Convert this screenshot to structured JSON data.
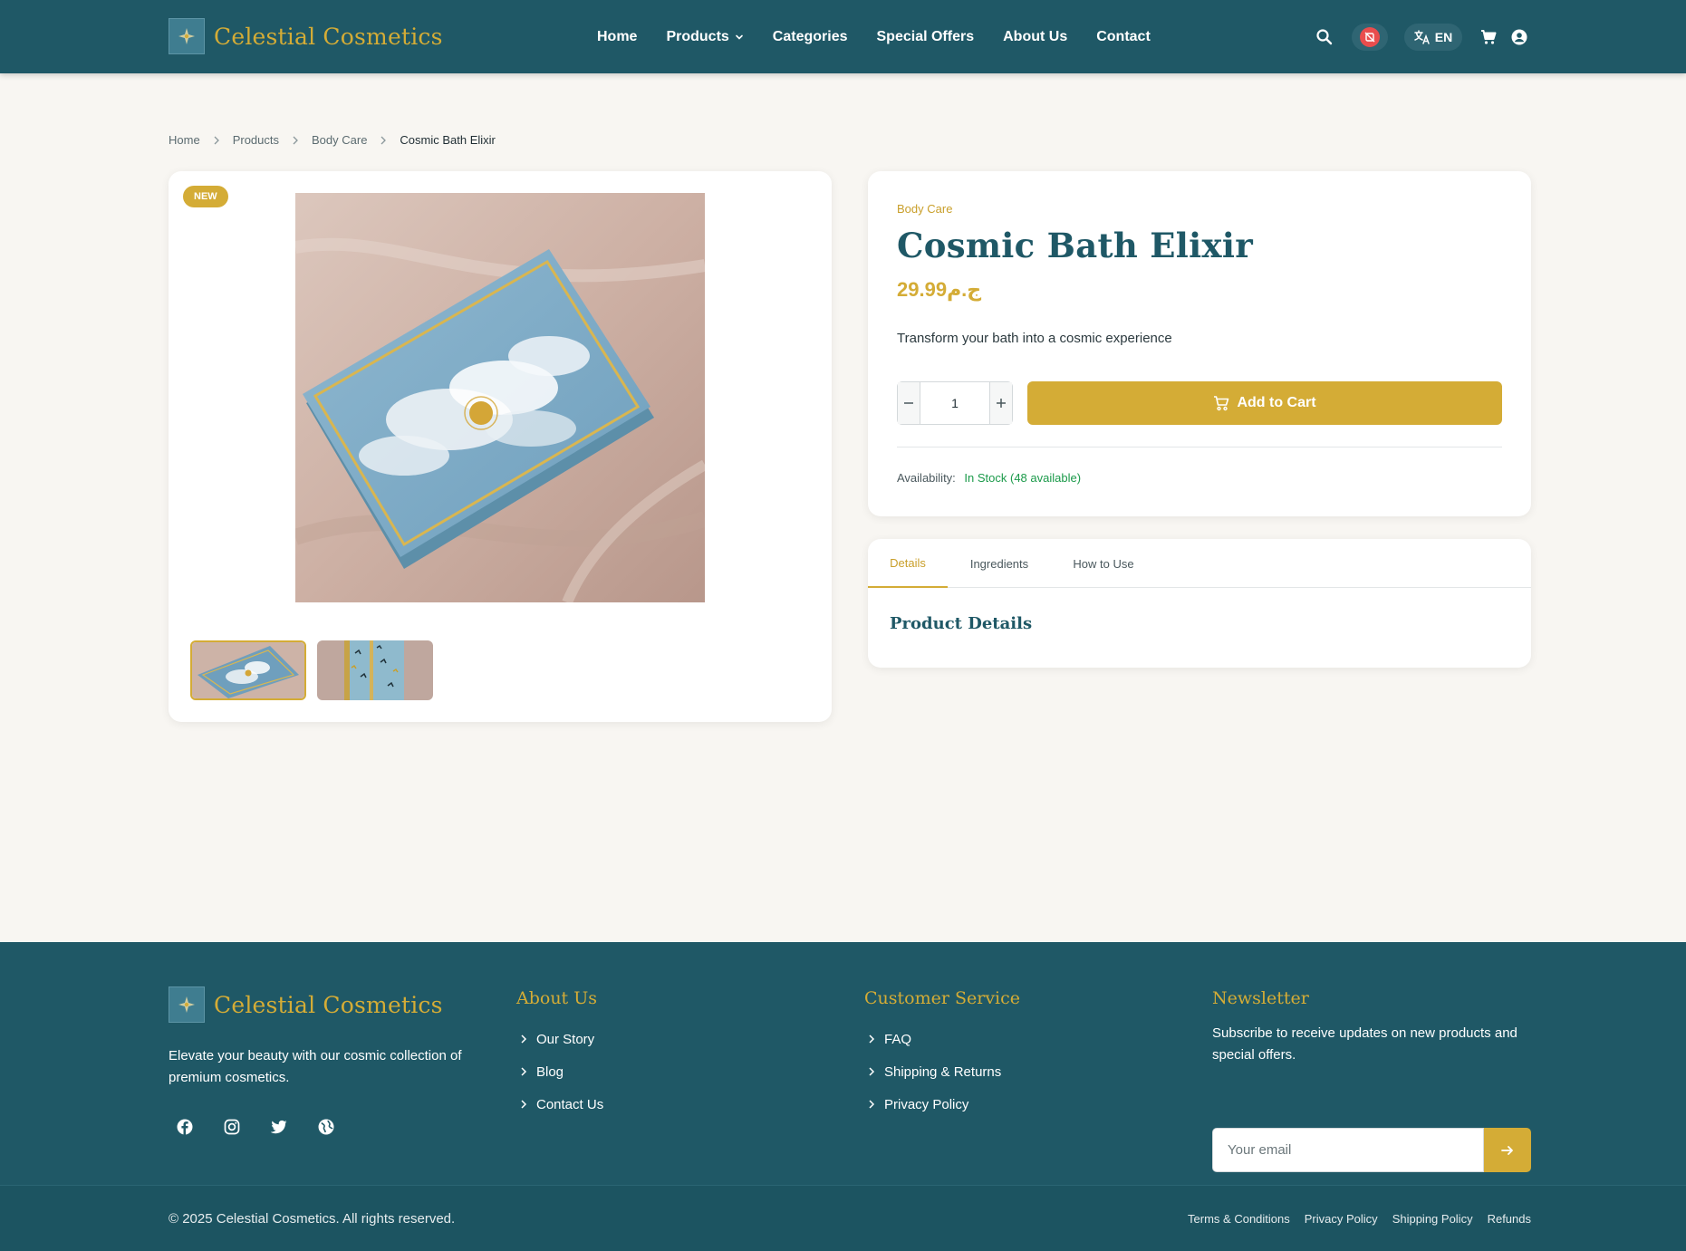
{
  "brand": {
    "name": "Celestial Cosmetics",
    "accent_color": "#d4ac36",
    "primary_color": "#1f5866"
  },
  "nav": {
    "items": [
      {
        "label": "Home"
      },
      {
        "label": "Products"
      },
      {
        "label": "Categories"
      },
      {
        "label": "Special Offers"
      },
      {
        "label": "About Us"
      },
      {
        "label": "Contact"
      }
    ],
    "language": "EN",
    "icons": [
      "search-icon",
      "notifications-off-icon",
      "translate-icon",
      "cart-icon",
      "account-icon"
    ]
  },
  "breadcrumb": [
    "Home",
    "Products",
    "Body Care",
    "Cosmic Bath Elixir"
  ],
  "gallery": {
    "badge": "NEW",
    "selected_thumbnail": 1
  },
  "product": {
    "category": "Body Care",
    "title": "Cosmic Bath Elixir",
    "price": "29.99ج.م",
    "description": "Transform your bath into a cosmic experience",
    "quantity": "1",
    "add_to_cart_label": "Add to Cart",
    "availability_label": "Availability:",
    "availability_value": "In Stock (48 available)"
  },
  "tabs": {
    "items": [
      {
        "label": "Details"
      },
      {
        "label": "Ingredients"
      },
      {
        "label": "How to Use"
      }
    ],
    "active": "Details",
    "heading": "Product Details"
  },
  "footer": {
    "tagline": "Elevate your beauty with our cosmic collection of premium cosmetics.",
    "socials": [
      "facebook-icon",
      "instagram-icon",
      "twitter-icon",
      "globe-icon"
    ],
    "about": {
      "title": "About Us",
      "links": [
        "Our Story",
        "Blog",
        "Contact Us"
      ]
    },
    "service": {
      "title": "Customer Service",
      "links": [
        "FAQ",
        "Shipping & Returns",
        "Privacy Policy"
      ]
    },
    "newsletter": {
      "title": "Newsletter",
      "text": "Subscribe to receive updates on new products and special offers.",
      "placeholder": "Your email"
    },
    "copyright": "© 2025 Celestial Cosmetics. All rights reserved.",
    "legal": [
      "Terms & Conditions",
      "Privacy Policy",
      "Shipping Policy",
      "Refunds"
    ]
  }
}
